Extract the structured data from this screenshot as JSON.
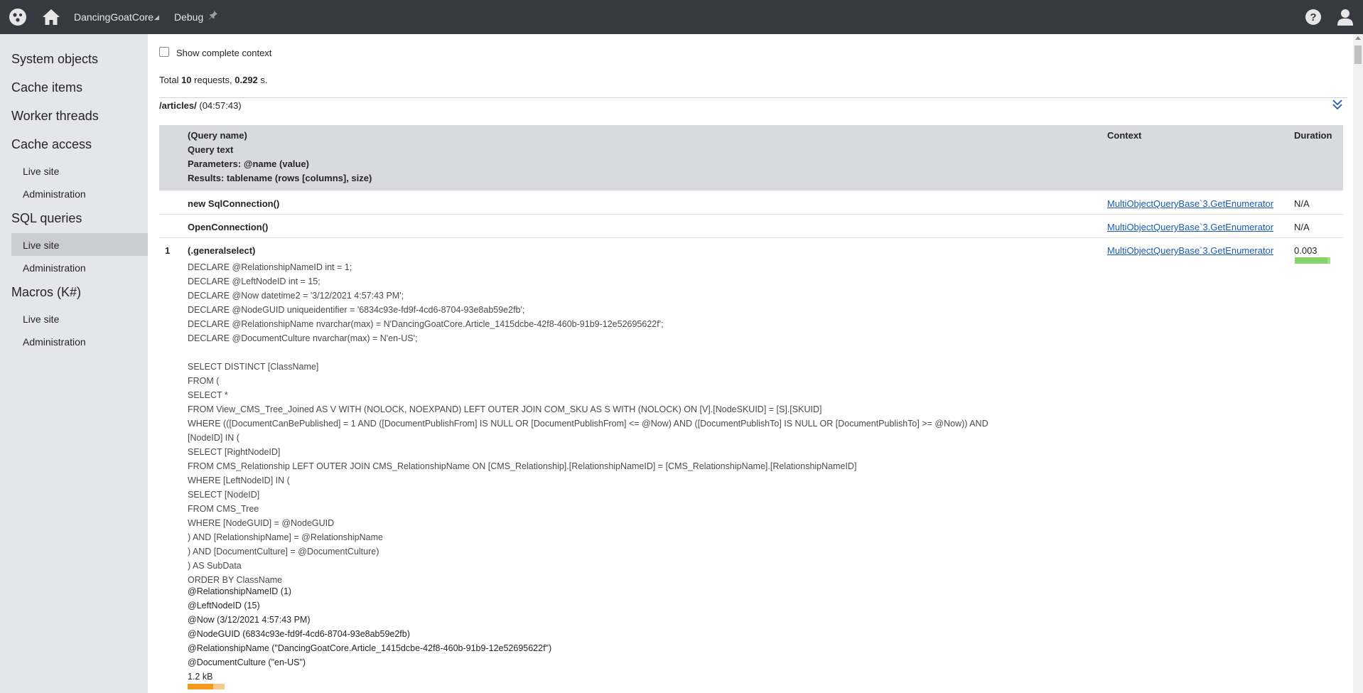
{
  "topbar": {
    "logo_icon": "kentico-logo-icon",
    "home_icon": "home-icon",
    "site_name": "DancingGoatCore",
    "site_caret": "◢",
    "breadcrumb": "Debug",
    "pin_icon": "pin-icon",
    "help_icon": "help-icon",
    "user_icon": "user-icon"
  },
  "sidebar": {
    "items": [
      {
        "label": "System objects"
      },
      {
        "label": "Cache items"
      },
      {
        "label": "Worker threads"
      },
      {
        "label": "Cache access"
      },
      {
        "label": "Live site"
      },
      {
        "label": "Administration"
      },
      {
        "label": "SQL queries"
      },
      {
        "label": "Live site"
      },
      {
        "label": "Administration"
      },
      {
        "label": "Macros (K#)"
      },
      {
        "label": "Live site"
      },
      {
        "label": "Administration"
      }
    ]
  },
  "main": {
    "show_context_label": "Show complete context",
    "totals": {
      "prefix": "Total ",
      "requests": "10",
      "mid": " requests, ",
      "seconds": "0.292",
      "suffix": " s."
    },
    "request_path": "/articles/",
    "request_time": " (04:57:43)",
    "header": {
      "col1_line1": "(Query name)",
      "col1_line2": "Query text",
      "col1_line3": "Parameters: @name (value)",
      "col1_line4": "Results: tablename (rows [columns], size)",
      "col_context": "Context",
      "col_duration": "Duration"
    },
    "rows": [
      {
        "name": "new SqlConnection()",
        "context": "MultiObjectQueryBase`3.GetEnumerator",
        "duration": "N/A"
      },
      {
        "name": "OpenConnection()",
        "context": "MultiObjectQueryBase`3.GetEnumerator",
        "duration": "N/A"
      }
    ],
    "query": {
      "index": "1",
      "name": "(.generalselect)",
      "context": "MultiObjectQueryBase`3.GetEnumerator",
      "duration": "0.003",
      "duration_fraction": 0.92,
      "sql_lines": [
        "DECLARE @RelationshipNameID int = 1;",
        "DECLARE @LeftNodeID int = 15;",
        "DECLARE @Now datetime2 = '3/12/2021 4:57:43 PM';",
        "DECLARE @NodeGUID uniqueidentifier = '6834c93e-fd9f-4cd6-8704-93e8ab59e2fb';",
        "DECLARE @RelationshipName nvarchar(max) = N'DancingGoatCore.Article_1415dcbe-42f8-460b-91b9-12e52695622f';",
        "DECLARE @DocumentCulture nvarchar(max) = N'en-US';",
        "",
        "SELECT DISTINCT [ClassName]",
        "FROM (",
        "SELECT *",
        "FROM View_CMS_Tree_Joined AS V WITH (NOLOCK, NOEXPAND) LEFT OUTER JOIN COM_SKU AS S WITH (NOLOCK) ON [V].[NodeSKUID] = [S].[SKUID]",
        "WHERE (([DocumentCanBePublished] = 1 AND ([DocumentPublishFrom] IS NULL OR [DocumentPublishFrom] <= @Now) AND ([DocumentPublishTo] IS NULL OR [DocumentPublishTo] >= @Now)) AND",
        "[NodeID] IN (",
        "SELECT [RightNodeID]",
        "FROM CMS_Relationship LEFT OUTER JOIN CMS_RelationshipName ON [CMS_Relationship].[RelationshipNameID] = [CMS_RelationshipName].[RelationshipNameID]",
        "WHERE [LeftNodeID] IN (",
        "SELECT [NodeID]",
        "FROM CMS_Tree",
        "WHERE [NodeGUID] = @NodeGUID",
        ") AND [RelationshipName] = @RelationshipName",
        ") AND [DocumentCulture] = @DocumentCulture)",
        ") AS SubData",
        "ORDER BY ClassName"
      ],
      "param_lines": [
        "@RelationshipNameID (1)",
        "@LeftNodeID (15)",
        "@Now (3/12/2021 4:57:43 PM)",
        "@NodeGUID (6834c93e-fd9f-4cd6-8704-93e8ab59e2fb)",
        "@RelationshipName (\"DancingGoatCore.Article_1415dcbe-42f8-460b-91b9-12e52695622f\")",
        "@DocumentCulture (\"en-US\")",
        "1.2 kB"
      ],
      "size_fraction": 0.7
    }
  },
  "colors": {
    "topbar": "#363a40",
    "sidebar": "#e5e6e9",
    "link": "#1a5bb4",
    "duration_bar": "#84d46a",
    "size_bar": "#f19a1f"
  }
}
